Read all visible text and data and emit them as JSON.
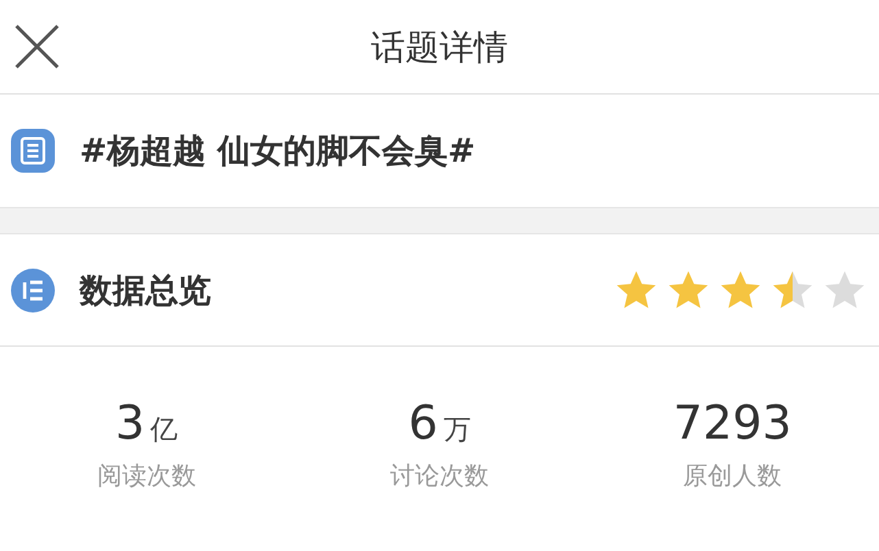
{
  "header": {
    "title": "话题详情"
  },
  "topic": {
    "title": "#杨超越 仙女的脚不会臭#"
  },
  "overview": {
    "title": "数据总览",
    "stars": 3.5,
    "stats": [
      {
        "value": "3",
        "unit": "亿",
        "label": "阅读次数"
      },
      {
        "value": "6",
        "unit": "万",
        "label": "讨论次数"
      },
      {
        "value": "7293",
        "label": "原创人数"
      }
    ]
  }
}
